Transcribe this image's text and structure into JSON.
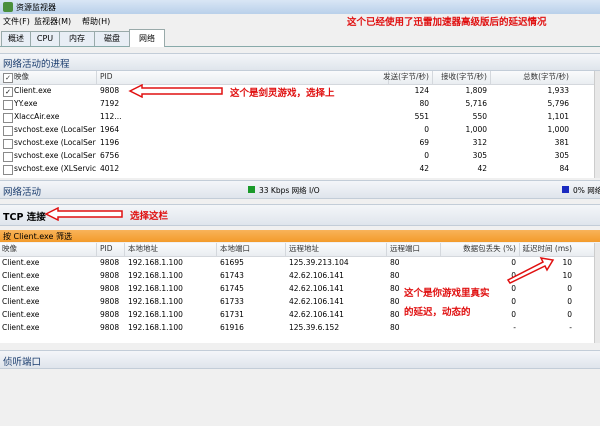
{
  "window": {
    "title": "资源监视器"
  },
  "menu": {
    "file": "文件(F)",
    "monitor": "监视器(M)",
    "help": "帮助(H)"
  },
  "annotations": {
    "top": "这个已经使用了迅雷加速器高级版后的延迟情况",
    "game": "这个是剑灵游戏，选择上",
    "select_bar": "选择这栏",
    "latency": "这个是你游戏里真实的延迟，动态的"
  },
  "tabs": [
    "概述",
    "CPU",
    "内存",
    "磁盘",
    "网络"
  ],
  "active_tab": "网络",
  "processes": {
    "header": "网络活动的进程",
    "columns": {
      "name": "映像",
      "pid": "PID",
      "send": "发送(字节/秒)",
      "recv": "接收(字节/秒)",
      "total": "总数(字节/秒)"
    },
    "rows": [
      {
        "name": "Client.exe",
        "pid": "9808",
        "send": "124",
        "recv": "1,809",
        "total": "1,933",
        "checked": true
      },
      {
        "name": "YY.exe",
        "pid": "7192",
        "send": "80",
        "recv": "5,716",
        "total": "5,796",
        "checked": false
      },
      {
        "name": "XlaccAir.exe",
        "pid": "112...",
        "send": "551",
        "recv": "550",
        "total": "1,101",
        "checked": false
      },
      {
        "name": "svchost.exe (LocalServi...",
        "pid": "1964",
        "send": "0",
        "recv": "1,000",
        "total": "1,000",
        "checked": false
      },
      {
        "name": "svchost.exe (LocalServi...",
        "pid": "1196",
        "send": "69",
        "recv": "312",
        "total": "381",
        "checked": false
      },
      {
        "name": "svchost.exe (LocalServi...",
        "pid": "6756",
        "send": "0",
        "recv": "305",
        "total": "305",
        "checked": false
      },
      {
        "name": "svchost.exe (XLService...",
        "pid": "4012",
        "send": "42",
        "recv": "42",
        "total": "84",
        "checked": false
      }
    ]
  },
  "network_activity": {
    "title": "网络活动",
    "io": "33 Kbps 网络 I/O",
    "util": "0% 网络",
    "io_color": "#1a9a2a",
    "util_color": "#1a2ac0"
  },
  "tcp": {
    "title": "TCP 连接",
    "filter": "按 Client.exe 筛选",
    "columns": {
      "name": "映像",
      "pid": "PID",
      "local_addr": "本地地址",
      "local_port": "本地端口",
      "remote_addr": "远程地址",
      "remote_port": "远程端口",
      "loss": "数据包丢失 (%)",
      "latency": "延迟时间 (ms)"
    },
    "rows": [
      {
        "name": "Client.exe",
        "pid": "9808",
        "local_addr": "192.168.1.100",
        "local_port": "61695",
        "remote_addr": "125.39.213.104",
        "remote_port": "80",
        "loss": "0",
        "latency": "10"
      },
      {
        "name": "Client.exe",
        "pid": "9808",
        "local_addr": "192.168.1.100",
        "local_port": "61743",
        "remote_addr": "42.62.106.141",
        "remote_port": "80",
        "loss": "0",
        "latency": "10"
      },
      {
        "name": "Client.exe",
        "pid": "9808",
        "local_addr": "192.168.1.100",
        "local_port": "61745",
        "remote_addr": "42.62.106.141",
        "remote_port": "80",
        "loss": "0",
        "latency": "0"
      },
      {
        "name": "Client.exe",
        "pid": "9808",
        "local_addr": "192.168.1.100",
        "local_port": "61733",
        "remote_addr": "42.62.106.141",
        "remote_port": "80",
        "loss": "0",
        "latency": "0"
      },
      {
        "name": "Client.exe",
        "pid": "9808",
        "local_addr": "192.168.1.100",
        "local_port": "61731",
        "remote_addr": "42.62.106.141",
        "remote_port": "80",
        "loss": "0",
        "latency": "0"
      },
      {
        "name": "Client.exe",
        "pid": "9808",
        "local_addr": "192.168.1.100",
        "local_port": "61916",
        "remote_addr": "125.39.6.152",
        "remote_port": "80",
        "loss": "-",
        "latency": "-"
      }
    ]
  },
  "listening": {
    "title": "侦听端口"
  },
  "colors": {
    "annotation": "#e01010",
    "filter_bar": "#f39b2b",
    "accent": "#1a3c6e"
  }
}
